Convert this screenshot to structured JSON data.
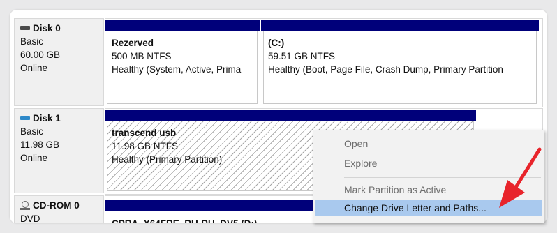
{
  "disks": [
    {
      "name": "Disk 0",
      "type": "Basic",
      "size": "60.00 GB",
      "status": "Online",
      "partitions": [
        {
          "name": "Rezerved",
          "info": "500 MB NTFS",
          "status": "Healthy (System, Active, Prima"
        },
        {
          "name": "(C:)",
          "info": "59.51 GB NTFS",
          "status": "Healthy (Boot, Page File, Crash Dump, Primary Partition"
        }
      ]
    },
    {
      "name": "Disk 1",
      "type": "Basic",
      "size": "11.98 GB",
      "status": "Online",
      "partitions": [
        {
          "name": "transcend usb",
          "info": "11.98 GB NTFS",
          "status": "Healthy (Primary Partition)"
        }
      ]
    },
    {
      "name": "CD-ROM 0",
      "type": "DVD",
      "partitions": [
        {
          "name": "CPRA_X64FRE_RU-RU_DV5 (D:)"
        }
      ]
    }
  ],
  "context_menu": {
    "items": [
      {
        "label": "Open",
        "enabled": false
      },
      {
        "label": "Explore",
        "enabled": false
      },
      {
        "label": "Mark Partition as Active",
        "enabled": false
      },
      {
        "label": "Change Drive Letter and Paths...",
        "enabled": true,
        "highlighted": true
      }
    ]
  },
  "colors": {
    "partition_bar": "#00007a",
    "menu_highlight": "#a9c9ee",
    "arrow": "#e8242b",
    "usb_icon": "#2e89c9"
  }
}
